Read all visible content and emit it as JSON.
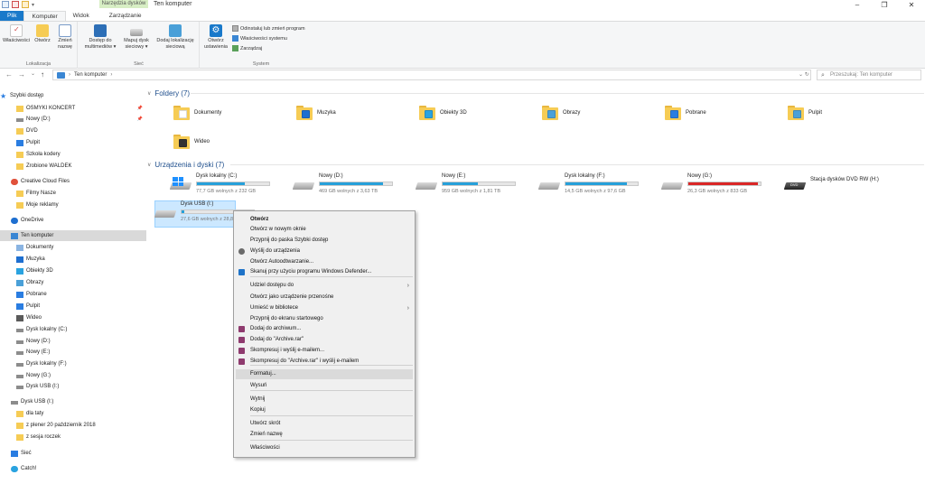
{
  "window": {
    "title": "Ten komputer",
    "context_tab_group": "Narzędzia dysków",
    "controls": [
      "–",
      "❐",
      "✕"
    ]
  },
  "ribbon_tabs": [
    {
      "label": "Plik"
    },
    {
      "label": "Komputer"
    },
    {
      "label": "Widok"
    },
    {
      "label": "Zarządzanie"
    }
  ],
  "ribbon": {
    "groups": {
      "lokalizacja": "Lokalizacja",
      "siec": "Sieć",
      "system": "System"
    },
    "buttons": {
      "wlasciwosci": "Właściwości",
      "otworz": "Otwórz",
      "zmien_nazwe_1": "Zmień",
      "zmien_nazwe_2": "nazwę",
      "dostep_1": "Dostęp do",
      "dostep_2": "multimediów ▾",
      "mapuj_1": "Mapuj dysk",
      "mapuj_2": "sieciowy ▾",
      "dodaj_1": "Dodaj lokalizację",
      "dodaj_2": "sieciową",
      "ustawienia_1": "Otwórz",
      "ustawienia_2": "ustawienia",
      "odinstaluj": "Odinstaluj lub zmień program",
      "wlasciwosci_systemu": "Właściwości systemu",
      "zarzadzaj": "Zarządzaj"
    }
  },
  "address": {
    "back": "←",
    "forward": "→",
    "history": "⌄",
    "up": "↑",
    "path": "Ten komputer",
    "sep": "›",
    "dropdown": "⌄ ↻",
    "search_placeholder": "Przeszukaj: Ten komputer"
  },
  "sidebar": {
    "items": [
      {
        "label": "Szybki dostęp",
        "icon": "star-icon",
        "color": "#2a7de1",
        "pin": ""
      },
      {
        "label": "OSMYKI KONCERT",
        "icon": "folder-icon",
        "color": "#f6cc55",
        "pin": "📌"
      },
      {
        "label": "Nowy (D:)",
        "icon": "drive-icon",
        "color": "#8c8c8c",
        "pin": "📌"
      },
      {
        "label": "DVD",
        "icon": "folder-icon",
        "color": "#f6cc55",
        "pin": ""
      },
      {
        "label": "Pulpit",
        "icon": "desktop-icon",
        "color": "#2a7de1",
        "pin": ""
      },
      {
        "label": "Szkoła kodery",
        "icon": "folder-icon",
        "color": "#f6cc55",
        "pin": ""
      },
      {
        "label": "Zrobione WALDEK",
        "icon": "folder-icon",
        "color": "#f6cc55",
        "pin": ""
      },
      {
        "label": "Creative Cloud Files",
        "icon": "creative-cloud-icon",
        "color": "#e0513b",
        "pin": ""
      },
      {
        "label": "Filmy Nasze",
        "icon": "folder-icon",
        "color": "#f6cc55",
        "pin": ""
      },
      {
        "label": "Moje reklamy",
        "icon": "folder-icon",
        "color": "#f6cc55",
        "pin": ""
      },
      {
        "label": "OneDrive",
        "icon": "cloud-icon",
        "color": "#1e6fd0",
        "pin": ""
      },
      {
        "label": "Ten komputer",
        "icon": "computer-icon",
        "color": "#3a86d3",
        "pin": ""
      },
      {
        "label": "Dokumenty",
        "icon": "documents-icon",
        "color": "#8ab4e2",
        "pin": ""
      },
      {
        "label": "Muzyka",
        "icon": "music-icon",
        "color": "#1e6fd0",
        "pin": ""
      },
      {
        "label": "Obiekty 3D",
        "icon": "cube-icon",
        "color": "#2aa3e0",
        "pin": ""
      },
      {
        "label": "Obrazy",
        "icon": "pictures-icon",
        "color": "#4aa0d8",
        "pin": ""
      },
      {
        "label": "Pobrane",
        "icon": "download-icon",
        "color": "#2a7de1",
        "pin": ""
      },
      {
        "label": "Pulpit",
        "icon": "desktop-icon",
        "color": "#2a7de1",
        "pin": ""
      },
      {
        "label": "Wideo",
        "icon": "video-icon",
        "color": "#5a5a5a",
        "pin": ""
      },
      {
        "label": "Dysk lokalny (C:)",
        "icon": "windows-drive-icon",
        "color": "#8c8c8c",
        "pin": ""
      },
      {
        "label": "Nowy (D:)",
        "icon": "drive-icon",
        "color": "#8c8c8c",
        "pin": ""
      },
      {
        "label": "Nowy (E:)",
        "icon": "drive-icon",
        "color": "#8c8c8c",
        "pin": ""
      },
      {
        "label": "Dysk lokalny (F:)",
        "icon": "drive-icon",
        "color": "#8c8c8c",
        "pin": ""
      },
      {
        "label": "Nowy (G:)",
        "icon": "drive-icon",
        "color": "#8c8c8c",
        "pin": ""
      },
      {
        "label": "Dysk USB (I:)",
        "icon": "usb-drive-icon",
        "color": "#8c8c8c",
        "pin": ""
      },
      {
        "label": "Dysk USB (I:)",
        "icon": "usb-drive-icon",
        "color": "#8c8c8c",
        "pin": ""
      },
      {
        "label": "dla taty",
        "icon": "folder-icon",
        "color": "#f6cc55",
        "pin": ""
      },
      {
        "label": "z plener 20 październik 2018",
        "icon": "folder-icon",
        "color": "#f6cc55",
        "pin": ""
      },
      {
        "label": "z sesja roczek",
        "icon": "folder-icon",
        "color": "#f6cc55",
        "pin": ""
      },
      {
        "label": "Sieć",
        "icon": "network-icon",
        "color": "#2a7de1",
        "pin": ""
      },
      {
        "label": "Catch!",
        "icon": "catch-icon",
        "color": "#2aa3e0",
        "pin": ""
      }
    ]
  },
  "folders_section": {
    "title": "Foldery (7)",
    "chevron": "∨",
    "items": [
      {
        "label": "Dokumenty",
        "badge_color": "#ffffff"
      },
      {
        "label": "Muzyka",
        "badge_color": "#1e6fd0"
      },
      {
        "label": "Obiekty 3D",
        "badge_color": "#2aa3e0"
      },
      {
        "label": "Obrazy",
        "badge_color": "#4aa0d8"
      },
      {
        "label": "Pobrane",
        "badge_color": "#2a7de1"
      },
      {
        "label": "Pulpit",
        "badge_color": "#4aa0d8"
      },
      {
        "label": "Wideo",
        "badge_color": "#333333"
      }
    ]
  },
  "drives_section": {
    "title": "Urządzenia i dyski (7)",
    "chevron": "∨",
    "items": [
      {
        "name": "Dysk lokalny (C:)",
        "free": "77,7 GB wolnych z 232 GB",
        "used_fraction": 0.665,
        "kind": "windows"
      },
      {
        "name": "Nowy (D:)",
        "free": "469 GB wolnych z 3,63 TB",
        "used_fraction": 0.874,
        "kind": "hdd"
      },
      {
        "name": "Nowy (E:)",
        "free": "959 GB wolnych z 1,81 TB",
        "used_fraction": 0.483,
        "kind": "hdd"
      },
      {
        "name": "Dysk lokalny (F:)",
        "free": "14,5 GB wolnych z 97,6 GB",
        "used_fraction": 0.851,
        "kind": "hdd"
      },
      {
        "name": "Nowy (G:)",
        "free": "26,3 GB wolnych z 833 GB",
        "used_fraction": 0.968,
        "kind": "hdd"
      },
      {
        "name": "Stacja dysków DVD RW (H:)",
        "free": "",
        "used_fraction": null,
        "kind": "dvd"
      },
      {
        "name": "Dysk USB (I:)",
        "free": "27,6 GB wolnych z 28,8 GB",
        "used_fraction": 0.042,
        "kind": "usb"
      }
    ]
  },
  "context_menu": {
    "items": [
      {
        "label": "Otwórz",
        "bold": true,
        "icon": ""
      },
      {
        "label": "Otwórz w nowym oknie",
        "icon": ""
      },
      {
        "label": "Przypnij do paska Szybki dostęp",
        "icon": ""
      },
      {
        "label": "Wyślij do urządzenia",
        "icon": "cast-icon"
      },
      {
        "label": "Otwórz Autoodtwarzanie...",
        "icon": ""
      },
      {
        "label": "Skanuj przy użyciu programu Windows Defender...",
        "icon": "defender-icon"
      },
      {
        "label": "Udziel dostępu do",
        "arrow": "›"
      },
      {
        "label": "Otwórz jako urządzenie przenośne",
        "icon": ""
      },
      {
        "label": "Umieść w bibliotece",
        "arrow": "›"
      },
      {
        "label": "Przypnij do ekranu startowego",
        "icon": ""
      },
      {
        "label": "Dodaj do archiwum...",
        "icon": "winrar-icon"
      },
      {
        "label": "Dodaj do \"Archive.rar\"",
        "icon": "winrar-icon"
      },
      {
        "label": "Skompresuj i wyślij e-mailem...",
        "icon": "winrar-icon"
      },
      {
        "label": "Skompresuj do \"Archive.rar\" i wyślij e-mailem",
        "icon": "winrar-icon"
      },
      {
        "label": "Formatuj...",
        "icon": "",
        "highlighted": true
      },
      {
        "label": "Wysuń",
        "icon": ""
      },
      {
        "label": "Wytnij",
        "icon": ""
      },
      {
        "label": "Kopiuj",
        "icon": ""
      },
      {
        "label": "Utwórz skrót",
        "icon": ""
      },
      {
        "label": "Zmień nazwę",
        "icon": ""
      },
      {
        "label": "Właściwości",
        "icon": ""
      }
    ]
  }
}
